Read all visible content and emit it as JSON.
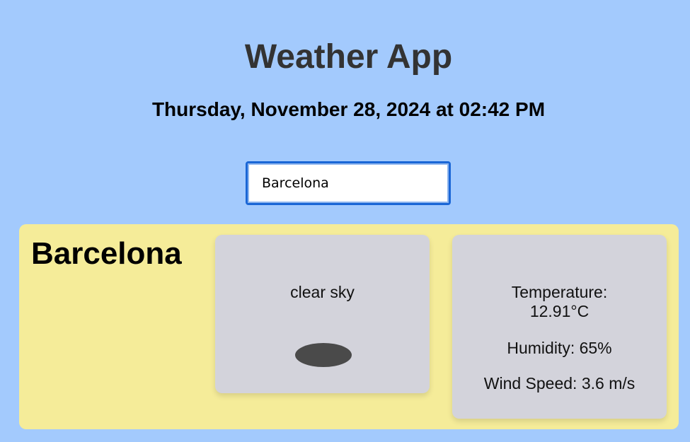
{
  "header": {
    "title": "Weather App",
    "datetime": "Thursday, November 28, 2024 at 02:42 PM"
  },
  "search": {
    "value": "Barcelona"
  },
  "weather": {
    "city": "Barcelona",
    "description": "clear sky",
    "icon": "clear-sky-icon",
    "temperature_label": "Temperature:",
    "temperature_value": "12.91°C",
    "humidity": "Humidity: 65%",
    "wind": "Wind Speed: 3.6 m/s"
  },
  "colors": {
    "background": "#a3cafd",
    "panel": "#f5ec99",
    "card": "#d3d3db",
    "input_border": "#1a66d6",
    "title": "#333333"
  }
}
